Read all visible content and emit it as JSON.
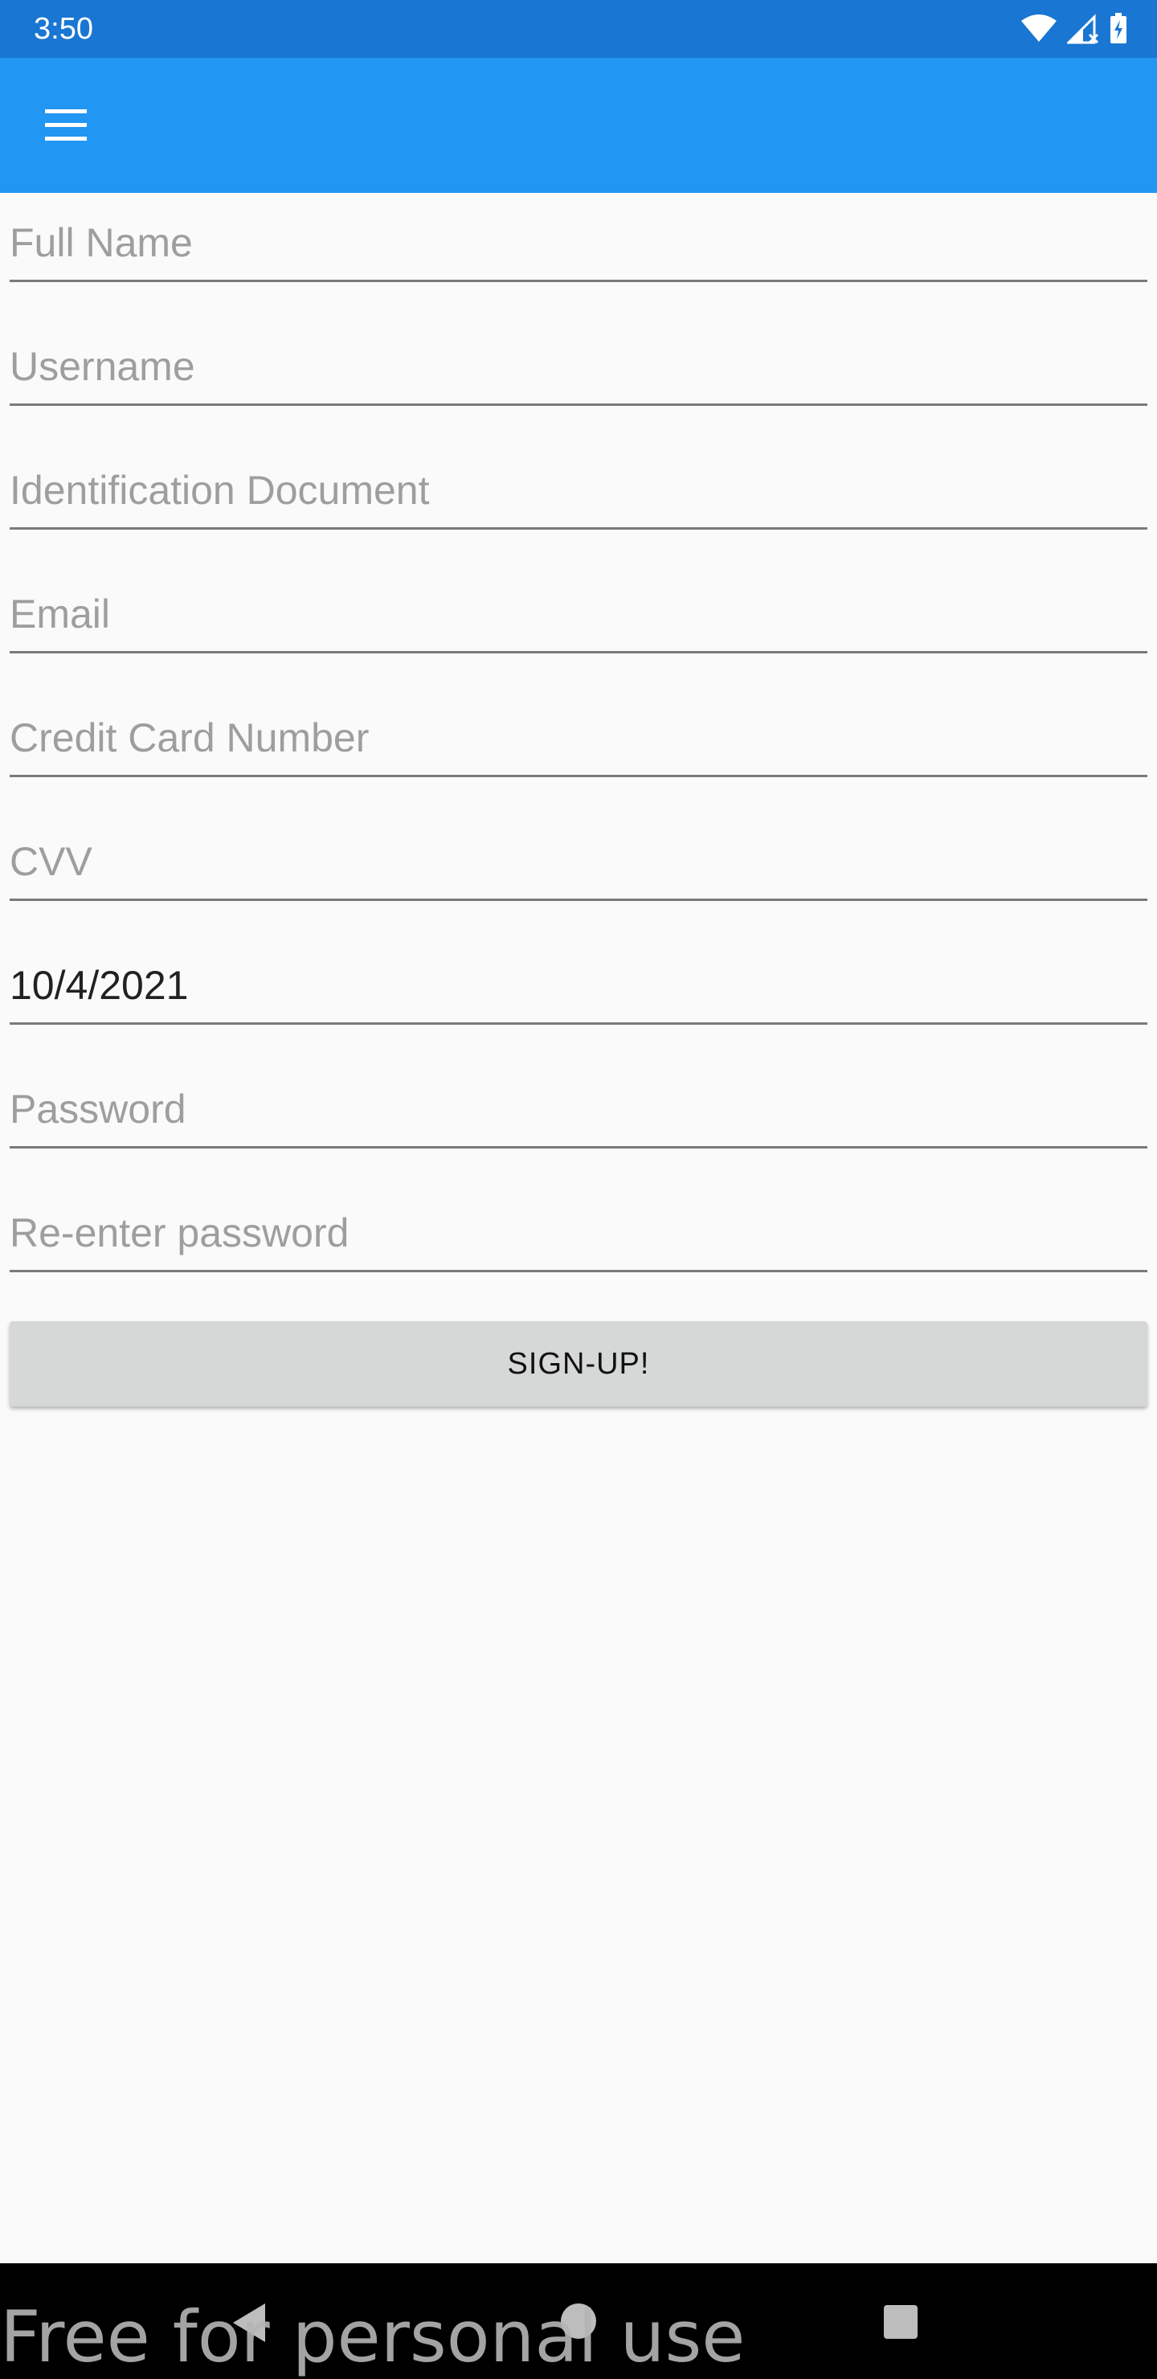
{
  "status_bar": {
    "time": "3:50",
    "icons": [
      "wifi-icon",
      "cell-signal-icon",
      "battery-charging-icon"
    ]
  },
  "app_bar": {
    "menu_icon": "hamburger-menu-icon",
    "accent_color": "#2196f3",
    "status_color": "#1976d2"
  },
  "form": {
    "full_name": {
      "placeholder": "Full Name",
      "value": ""
    },
    "username": {
      "placeholder": "Username",
      "value": ""
    },
    "id_document": {
      "placeholder": "Identification Document",
      "value": ""
    },
    "email": {
      "placeholder": "Email",
      "value": ""
    },
    "card_number": {
      "placeholder": "Credit Card Number",
      "value": ""
    },
    "cvv": {
      "placeholder": "CVV",
      "value": ""
    },
    "date": {
      "placeholder": "",
      "value": "10/4/2021"
    },
    "password": {
      "placeholder": "Password",
      "value": ""
    },
    "password_confirm": {
      "placeholder": "Re-enter password",
      "value": ""
    },
    "submit_label": "SIGN-UP!"
  },
  "nav_bar": {
    "icons": [
      "back-icon",
      "home-icon",
      "recents-icon"
    ]
  },
  "watermark": "Free for personal use"
}
